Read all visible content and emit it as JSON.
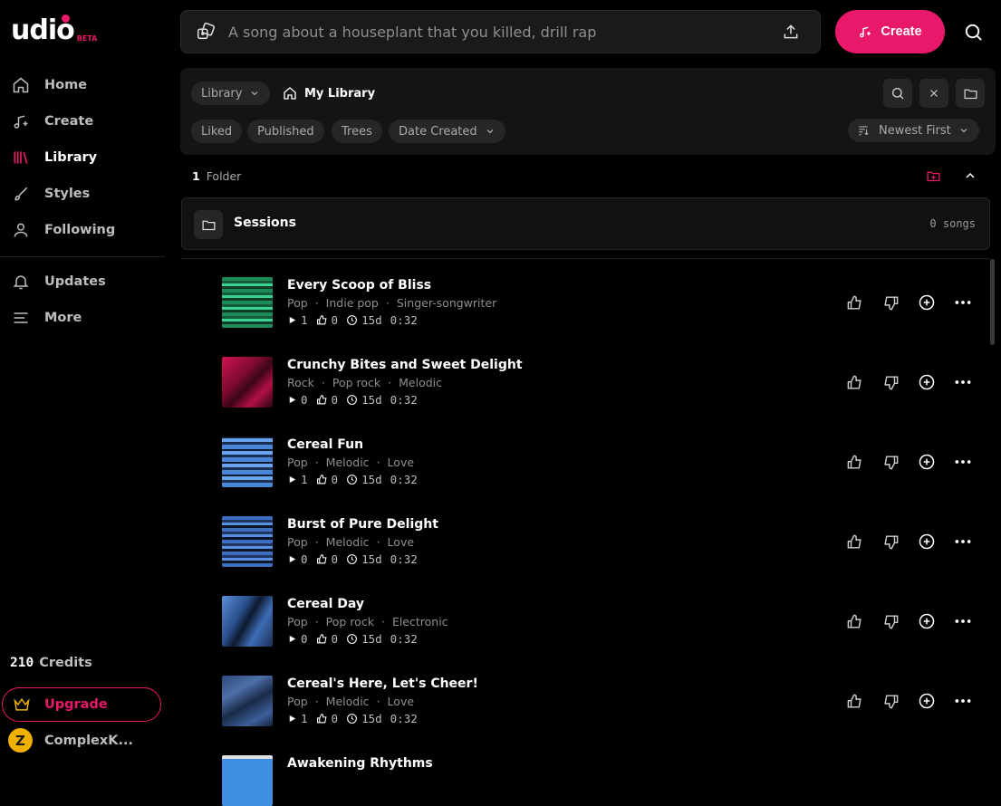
{
  "brand": {
    "name": "udio",
    "badge": "BETA"
  },
  "sidebar": {
    "primary": [
      {
        "label": "Home",
        "icon": "home-icon"
      },
      {
        "label": "Create",
        "icon": "music-plus-icon"
      },
      {
        "label": "Library",
        "icon": "library-icon",
        "active": true
      },
      {
        "label": "Styles",
        "icon": "brush-icon"
      },
      {
        "label": "Following",
        "icon": "person-icon"
      }
    ],
    "secondary": [
      {
        "label": "Updates",
        "icon": "bell-icon"
      },
      {
        "label": "More",
        "icon": "menu-icon"
      }
    ],
    "credits_value": "210",
    "credits_label": "Credits",
    "upgrade_label": "Upgrade",
    "user_initial": "Z",
    "user_name": "ComplexK..."
  },
  "topbar": {
    "prompt_placeholder": "A song about a houseplant that you killed, drill rap",
    "create_label": "Create"
  },
  "library": {
    "dropdown_label": "Library",
    "breadcrumb": "My Library",
    "filters": [
      "Liked",
      "Published",
      "Trees"
    ],
    "date_filter": "Date Created",
    "sort_label": "Newest First",
    "folder_count_value": "1",
    "folder_count_label": "Folder",
    "folder": {
      "name": "Sessions",
      "songs": "0 songs"
    }
  },
  "colors": {
    "accent": "#e8186a",
    "background": "#000000",
    "panel": "#141414"
  },
  "songs": [
    {
      "title": "Every Scoop of Bliss",
      "tags": [
        "Pop",
        "Indie pop",
        "Singer-songwriter"
      ],
      "plays": "1",
      "likes": "0",
      "age": "15d",
      "duration": "0:32",
      "art": "green"
    },
    {
      "title": "Crunchy Bites and Sweet Delight",
      "tags": [
        "Rock",
        "Pop rock",
        "Melodic"
      ],
      "plays": "0",
      "likes": "0",
      "age": "15d",
      "duration": "0:32",
      "art": "red"
    },
    {
      "title": "Cereal Fun",
      "tags": [
        "Pop",
        "Melodic",
        "Love"
      ],
      "plays": "1",
      "likes": "0",
      "age": "15d",
      "duration": "0:32",
      "art": "blue"
    },
    {
      "title": "Burst of Pure Delight",
      "tags": [
        "Pop",
        "Melodic",
        "Love"
      ],
      "plays": "0",
      "likes": "0",
      "age": "15d",
      "duration": "0:32",
      "art": "blue2"
    },
    {
      "title": "Cereal Day",
      "tags": [
        "Pop",
        "Pop rock",
        "Electronic"
      ],
      "plays": "0",
      "likes": "0",
      "age": "15d",
      "duration": "0:32",
      "art": "blue3"
    },
    {
      "title": "Cereal's Here, Let's Cheer!",
      "tags": [
        "Pop",
        "Melodic",
        "Love"
      ],
      "plays": "1",
      "likes": "0",
      "age": "15d",
      "duration": "0:32",
      "art": "poly"
    },
    {
      "title": "Awakening Rhythms",
      "tags": [],
      "plays": "",
      "likes": "",
      "age": "",
      "duration": "",
      "art": "sky"
    }
  ]
}
